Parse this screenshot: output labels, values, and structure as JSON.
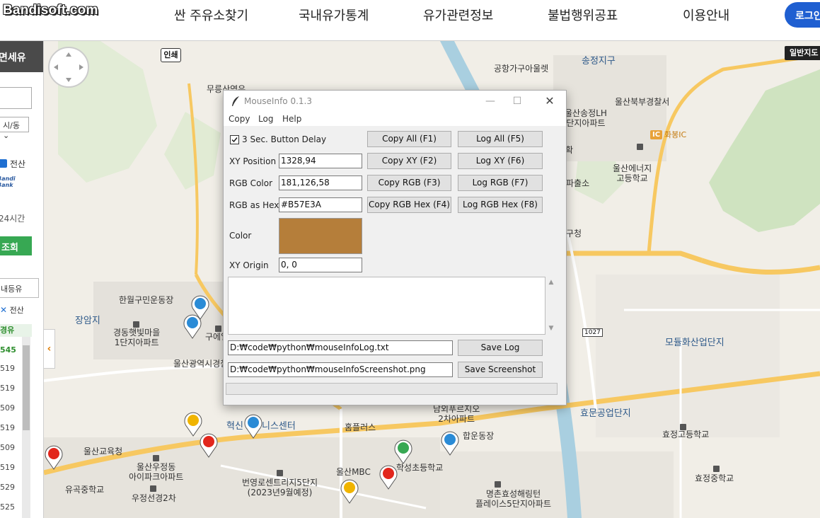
{
  "site": {
    "logo": "Bandisoft.com",
    "nav": [
      "싼 주유소찾기",
      "국내유가통계",
      "유가관련정보",
      "불법행위공표",
      "이용안내"
    ],
    "login": "로그인"
  },
  "sidebar": {
    "header": "면세유",
    "select": "시/동",
    "check_label": "전산",
    "bank_text": "Bandi\nBank",
    "hours": "24시간",
    "search_btn": "조회",
    "tab": "내등유",
    "brand": "전산",
    "list_head": "경유",
    "prices": [
      "545",
      "519",
      "519",
      "509",
      "519",
      "509",
      "519",
      "529",
      "525"
    ]
  },
  "map": {
    "print": "인쇄",
    "mode": "일반지도",
    "labels": [
      {
        "text": "송정지구",
        "kind": "blue"
      },
      {
        "text": "공항가구아울렛",
        "kind": "normal"
      },
      {
        "text": "무릉산역우",
        "kind": "normal"
      },
      {
        "text": "울산북부경찰서",
        "kind": "normal"
      },
      {
        "text": "울산송정LH\n단지아파트",
        "kind": "normal"
      },
      {
        "text": "화봉IC",
        "kind": "normal"
      },
      {
        "text": "울산에너지\n고등학교",
        "kind": "normal"
      },
      {
        "text": "한월구민운동장",
        "kind": "normal"
      },
      {
        "text": "장암지",
        "kind": "blue"
      },
      {
        "text": "경동햇빛마을\n1단지아파트",
        "kind": "normal"
      },
      {
        "text": "울산광역시경찰",
        "kind": "normal"
      },
      {
        "text": "모듈화산업단지",
        "kind": "blue"
      },
      {
        "text": "효문공업단지",
        "kind": "blue"
      },
      {
        "text": "효정고등학교",
        "kind": "normal"
      },
      {
        "text": "효정중학교",
        "kind": "normal"
      },
      {
        "text": "혁신",
        "kind": "blue"
      },
      {
        "text": "니스센터",
        "kind": "blue"
      },
      {
        "text": "홈플러스",
        "kind": "normal"
      },
      {
        "text": "남외푸르지오\n2차아파트",
        "kind": "normal"
      },
      {
        "text": "합운동장",
        "kind": "normal"
      },
      {
        "text": "울산교육청",
        "kind": "normal"
      },
      {
        "text": "울산우정동\n아이파크아파트",
        "kind": "normal"
      },
      {
        "text": "울산MBC",
        "kind": "normal"
      },
      {
        "text": "학성초등학교",
        "kind": "normal"
      },
      {
        "text": "유곡중학교",
        "kind": "normal"
      },
      {
        "text": "번영로센트리지5단지\n(2023년9월예정)",
        "kind": "normal"
      },
      {
        "text": "우정선경2차",
        "kind": "normal"
      },
      {
        "text": "명촌효성해링턴\n플레이스5단지아파트",
        "kind": "normal"
      },
      {
        "text": "구청",
        "kind": "normal"
      },
      {
        "text": "확",
        "kind": "normal"
      },
      {
        "text": "파출소",
        "kind": "normal"
      },
      {
        "text": "구에일",
        "kind": "normal"
      },
      {
        "text": "1027",
        "kind": "normal"
      }
    ]
  },
  "mouseinfo": {
    "title": "MouseInfo 0.1.3",
    "menu": [
      "Copy",
      "Log",
      "Help"
    ],
    "delay_label": "3 Sec. Button Delay",
    "delay_checked": true,
    "xy_label": "XY Position",
    "xy_value": "1328,94",
    "rgb_label": "RGB Color",
    "rgb_value": "181,126,58",
    "hex_label": "RGB as Hex",
    "hex_value": "#B57E3A",
    "color_label": "Color",
    "swatch_color": "#B57E3A",
    "origin_label": "XY Origin",
    "origin_value": "0, 0",
    "buttons": {
      "copy_all": "Copy All (F1)",
      "log_all": "Log All (F5)",
      "copy_xy": "Copy XY (F2)",
      "log_xy": "Log XY (F6)",
      "copy_rgb": "Copy RGB (F3)",
      "log_rgb": "Log RGB (F7)",
      "copy_hex": "Copy RGB Hex (F4)",
      "log_hex": "Log RGB Hex (F8)",
      "save_log": "Save Log",
      "save_screenshot": "Save Screenshot"
    },
    "log_path": "D:₩code₩python₩mouseInfoLog.txt",
    "screenshot_path": "D:₩code₩python₩mouseInfoScreenshot.png",
    "log_text": ""
  }
}
